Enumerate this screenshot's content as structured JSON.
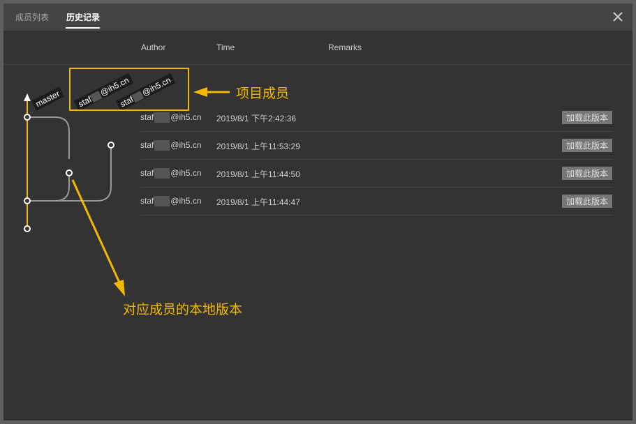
{
  "tabs": [
    {
      "label": "成员列表",
      "active": false
    },
    {
      "label": "历史记录",
      "active": true
    }
  ],
  "table": {
    "headers": {
      "author": "Author",
      "time": "Time",
      "remarks": "Remarks"
    },
    "rows": [
      {
        "author_prefix": "staf",
        "author_suffix": "@ih5.cn",
        "time": "2019/8/1 下午2:42:36",
        "action": "加载此版本"
      },
      {
        "author_prefix": "staf",
        "author_suffix": "@ih5.cn",
        "time": "2019/8/1 上午11:53:29",
        "action": "加载此版本"
      },
      {
        "author_prefix": "staf",
        "author_suffix": "@ih5.cn",
        "time": "2019/8/1 上午11:44:50",
        "action": "加载此版本"
      },
      {
        "author_prefix": "staf",
        "author_suffix": "@ih5.cn",
        "time": "2019/8/1 上午11:44:47",
        "action": "加载此版本"
      }
    ]
  },
  "graph": {
    "labels": {
      "master": "master",
      "member1_prefix": "staf",
      "member1_suffix": "@ih5.cn",
      "member2_prefix": "staf",
      "member2_suffix": "@ih5.cn"
    },
    "colors": {
      "master": "#f5b800",
      "branch": "#9a9a9a",
      "node_fill": "#333333",
      "node_stroke": "#ffffff"
    }
  },
  "annotations": {
    "project_members": "项目成员",
    "local_versions": "对应成员的本地版本",
    "color": "#f5b800"
  },
  "icons": {
    "close": "close-icon"
  }
}
